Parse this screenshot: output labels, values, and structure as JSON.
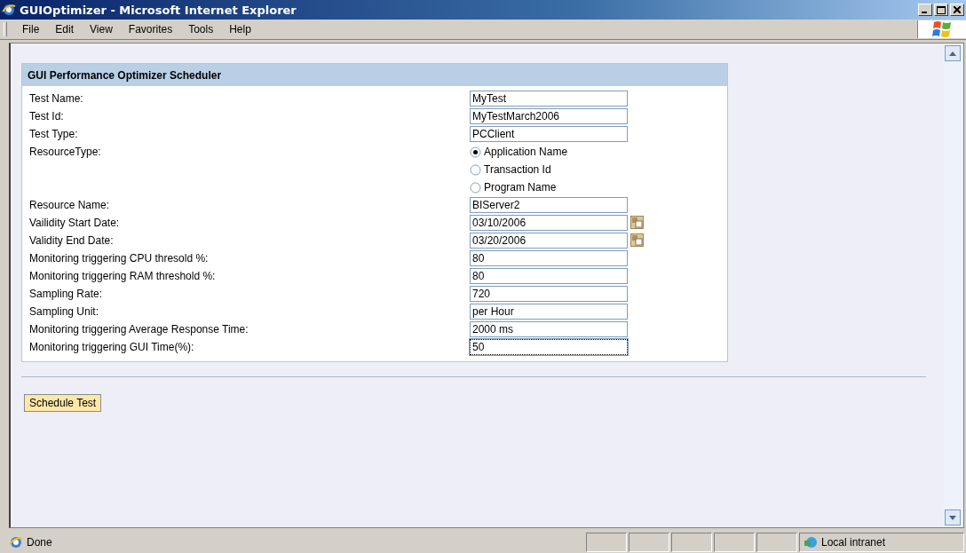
{
  "window": {
    "title": "GUIOptimizer - Microsoft Internet Explorer"
  },
  "menu": [
    "File",
    "Edit",
    "View",
    "Favorites",
    "Tools",
    "Help"
  ],
  "form": {
    "title": "GUI Performance Optimizer Scheduler",
    "rows": [
      {
        "kind": "text",
        "label": "Test Name:",
        "value": "MyTest",
        "focused": false
      },
      {
        "kind": "text",
        "label": "Test Id:",
        "value": "MyTestMarch2006",
        "focused": false
      },
      {
        "kind": "text",
        "label": "Test Type:",
        "value": "PCClient",
        "focused": false
      },
      {
        "kind": "radio",
        "label": "ResourceType:",
        "options": [
          {
            "label": "Application Name",
            "selected": true
          },
          {
            "label": "Transaction Id",
            "selected": false
          },
          {
            "label": "Program Name",
            "selected": false
          }
        ]
      },
      {
        "kind": "text",
        "label": "Resource Name:",
        "value": "BIServer2",
        "focused": false
      },
      {
        "kind": "date",
        "label": "Vailidity Start Date:",
        "value": "03/10/2006",
        "focused": false
      },
      {
        "kind": "date",
        "label": "Validity End Date:",
        "value": "03/20/2006",
        "focused": false
      },
      {
        "kind": "text",
        "label": "Monitoring triggering CPU thresold %:",
        "value": "80",
        "focused": false
      },
      {
        "kind": "text",
        "label": "Monitoring triggering RAM threshold %:",
        "value": "80",
        "focused": false
      },
      {
        "kind": "text",
        "label": "Sampling Rate:",
        "value": "720",
        "focused": false
      },
      {
        "kind": "text",
        "label": "Sampling Unit:",
        "value": "per Hour",
        "focused": false
      },
      {
        "kind": "text",
        "label": "Monitoring triggering Average Response Time:",
        "value": "2000 ms",
        "focused": false
      },
      {
        "kind": "text",
        "label": "Monitoring triggering GUI Time(%):",
        "value": "50",
        "focused": true
      }
    ]
  },
  "button": "Schedule Test",
  "status_bar": {
    "text": "Done",
    "zone": "Local intranet"
  }
}
